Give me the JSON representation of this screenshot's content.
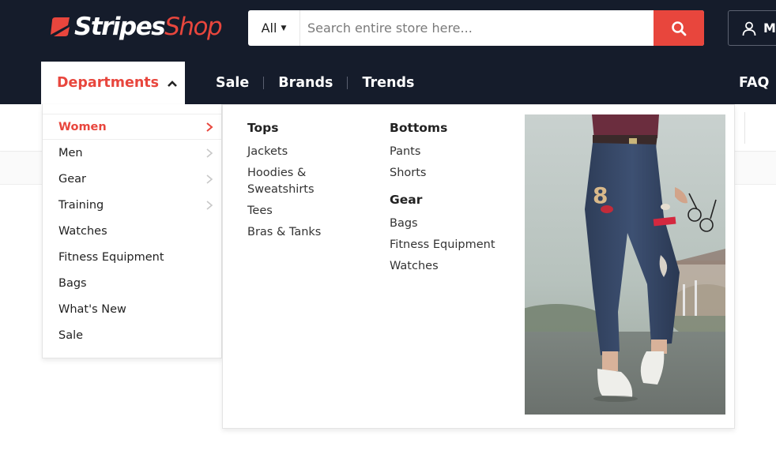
{
  "header": {
    "logo": {
      "brand_main": "Stripes",
      "brand_accent": "Shop"
    },
    "search": {
      "category": "All",
      "placeholder": "Search entire store here...",
      "value": ""
    },
    "account": {
      "initial": "M"
    }
  },
  "nav": {
    "departments_label": "Departments",
    "links": [
      "Sale",
      "Brands",
      "Trends"
    ],
    "faq": "FAQ"
  },
  "departments_menu": {
    "items": [
      {
        "label": "Women",
        "has_submenu": true,
        "active": true
      },
      {
        "label": "Men",
        "has_submenu": true,
        "active": false
      },
      {
        "label": "Gear",
        "has_submenu": true,
        "active": false
      },
      {
        "label": "Training",
        "has_submenu": true,
        "active": false
      },
      {
        "label": "Watches",
        "has_submenu": false,
        "active": false
      },
      {
        "label": "Fitness Equipment",
        "has_submenu": false,
        "active": false
      },
      {
        "label": "Bags",
        "has_submenu": false,
        "active": false
      },
      {
        "label": "What's New",
        "has_submenu": false,
        "active": false
      },
      {
        "label": "Sale",
        "has_submenu": false,
        "active": false
      }
    ]
  },
  "mega_menu": {
    "col1": {
      "heading": "Tops",
      "links": [
        "Jackets",
        "Hoodies & Sweatshirts",
        "Tees",
        "Bras & Tanks"
      ]
    },
    "col2": {
      "heading": "Bottoms",
      "links": [
        "Pants",
        "Shorts"
      ]
    },
    "col3": {
      "heading": "Gear",
      "links": [
        "Bags",
        "Fitness Equipment",
        "Watches"
      ]
    }
  },
  "colors": {
    "accent": "#e8463d",
    "header_bg": "#151c2b",
    "text": "#222222"
  },
  "icons": {
    "search": "search-icon",
    "account": "user-icon",
    "dept_toggle": "chevron-up-icon",
    "submenu": "chevron-right-icon"
  }
}
